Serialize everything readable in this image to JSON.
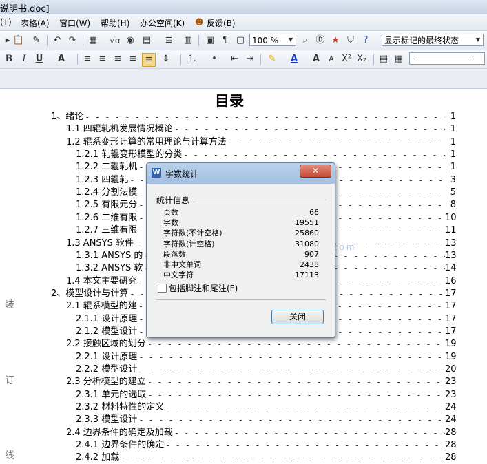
{
  "window": {
    "title": "说明书.doc]"
  },
  "menu": [
    "(T)",
    "表格(A)",
    "窗口(W)",
    "帮助(H)",
    "办公空间(K)",
    "反馈(B)"
  ],
  "toolbar": {
    "zoom": "100 %",
    "markup_view": "显示标记的最终状态",
    "icons": [
      "paste-icon",
      "format-painter-icon",
      "undo-icon",
      "redo-icon",
      "insert-table-icon",
      "formula-icon",
      "globe-icon",
      "table-icon",
      "columns-icon",
      "chart-icon",
      "document-map-icon",
      "find-icon",
      "word-count-icon",
      "help-icon"
    ]
  },
  "format_toolbar": {
    "bold": "B",
    "italic": "I",
    "underline": "U",
    "char_shade": "A",
    "font_color": "A",
    "grow_font": "A",
    "shrink_font": "A",
    "superscript": "X²",
    "subscript": "X₂"
  },
  "document": {
    "title": "目录",
    "toc": [
      {
        "label": "1、绪论",
        "page": "1"
      },
      {
        "label": "1.1 四辊轧机发展情况概论",
        "page": "1"
      },
      {
        "label": "1.2 辊系变形计算的常用理论与计算方法",
        "page": "1"
      },
      {
        "label": "1.2.1 轧辊变形模型的分类",
        "page": "1"
      },
      {
        "label": "1.2.2 二辊轧机",
        "page": "1"
      },
      {
        "label": "1.2.3  四辊轧",
        "page": "3"
      },
      {
        "label": "1.2.4 分割法模",
        "page": "5"
      },
      {
        "label": "1.2.5 有限元分",
        "page": "8"
      },
      {
        "label": "1.2.6 二维有限",
        "page": "10"
      },
      {
        "label": "1.2.7 三维有限",
        "page": "11"
      },
      {
        "label": "1.3 ANSYS 软件",
        "page": "13"
      },
      {
        "label": "1.3.1 ANSYS 的",
        "page": "13"
      },
      {
        "label": "1.3.2 ANSYS 软",
        "page": "14"
      },
      {
        "label": "1.4 本文主要研究",
        "page": "16"
      },
      {
        "label": "2、模型设计与计算",
        "page": "17"
      },
      {
        "label": "2.1 辊系模型的建",
        "page": "17"
      },
      {
        "label": "2.1.1 设计原理",
        "page": "17"
      },
      {
        "label": "2.1.2 模型设计",
        "page": "17"
      },
      {
        "label": "2.2 接触区域的划分",
        "page": "19"
      },
      {
        "label": "2.2.1 设计原理",
        "page": "19"
      },
      {
        "label": "2.2.2 模型设计",
        "page": "20"
      },
      {
        "label": "2.3 分析模型的建立",
        "page": "23"
      },
      {
        "label": "2.3.1 单元的选取",
        "page": "23"
      },
      {
        "label": "2.3.2 材料特性的定义",
        "page": "24"
      },
      {
        "label": "2.3.3 模型设计",
        "page": "24"
      },
      {
        "label": "2.4 边界条件的确定及加载",
        "page": "28"
      },
      {
        "label": "2.4.1 边界条件的确定",
        "page": "28"
      },
      {
        "label": "2.4.2 加载",
        "page": "28"
      }
    ],
    "gutter": [
      "装",
      "订",
      "线"
    ],
    "watermark_url": "www.renrendoc.com"
  },
  "dialog": {
    "title": "字数统计",
    "section": "统计信息",
    "stats": [
      {
        "label": "页数",
        "value": "66"
      },
      {
        "label": "字数",
        "value": "19551"
      },
      {
        "label": "字符数(不计空格)",
        "value": "25860"
      },
      {
        "label": "字符数(计空格)",
        "value": "31080"
      },
      {
        "label": "段落数",
        "value": "907"
      },
      {
        "label": "非中文单词",
        "value": "2438"
      },
      {
        "label": "中文字符",
        "value": "17113"
      }
    ],
    "include_notes_label": "包括脚注和尾注(F)",
    "include_notes_checked": false,
    "close_button": "关闭"
  }
}
